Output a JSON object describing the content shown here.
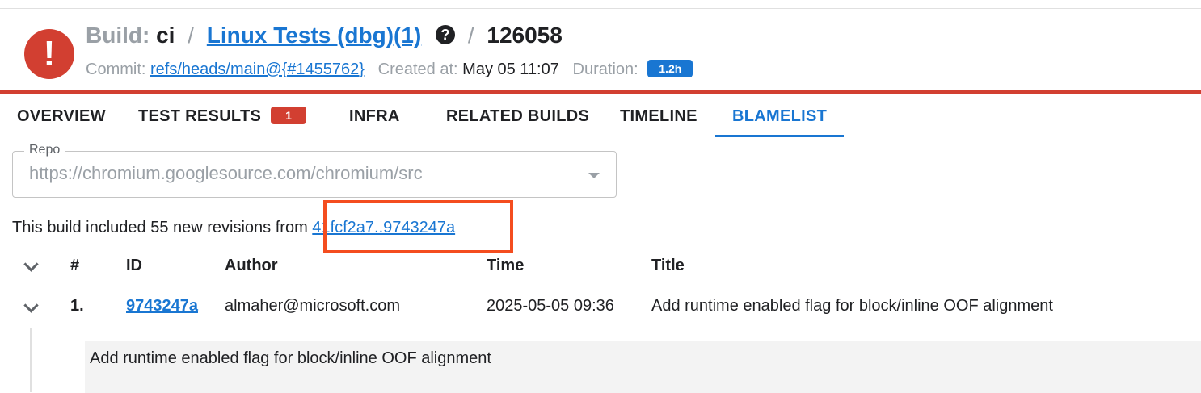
{
  "header": {
    "build_label": "Build:",
    "bucket": "ci",
    "separator": "/",
    "builder": "Linux Tests (dbg)(1)",
    "help_icon": "?",
    "build_number": "126058",
    "commit_label": "Commit:",
    "commit_ref": "refs/heads/main@{#1455762}",
    "created_label": "Created at:",
    "created_value": "May 05 11:07",
    "duration_label": "Duration:",
    "duration_value": "1.2h",
    "status_icon": "!"
  },
  "tabs": [
    {
      "label": "OVERVIEW"
    },
    {
      "label": "TEST RESULTS",
      "badge": "1"
    },
    {
      "label": "INFRA"
    },
    {
      "label": "RELATED BUILDS"
    },
    {
      "label": "TIMELINE"
    },
    {
      "label": "BLAMELIST",
      "active": true
    }
  ],
  "repo": {
    "legend": "Repo",
    "value": "https://chromium.googlesource.com/chromium/src"
  },
  "summary": {
    "text": "This build included 55 new revisions from ",
    "range": "41fcf2a7..9743247a"
  },
  "table": {
    "columns": [
      "#",
      "ID",
      "Author",
      "Time",
      "Title"
    ],
    "rows": [
      {
        "index": "1.",
        "id": "9743247a",
        "author": "almaher@microsoft.com",
        "time": "2025-05-05 09:36",
        "title": "Add runtime enabled flag for block/inline OOF alignment",
        "detail": "Add runtime enabled flag for block/inline OOF alignment"
      }
    ]
  },
  "colors": {
    "failure": "#d23f31",
    "accent": "#1976d2",
    "highlight": "#f44d1f"
  }
}
